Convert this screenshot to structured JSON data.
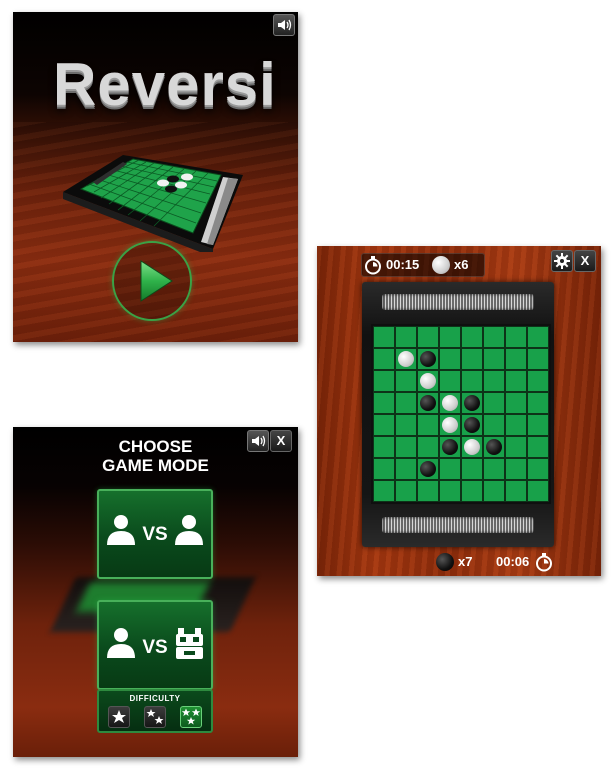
{
  "title_screen": {
    "logo": "Reversi",
    "sound_icon": "speaker-icon",
    "play_icon": "play-icon"
  },
  "mode_screen": {
    "title_line1": "CHOOSE",
    "title_line2": "GAME MODE",
    "vs_label": "VS",
    "difficulty_label": "DIFFICULTY",
    "difficulty_levels": [
      1,
      2,
      3
    ],
    "selected_difficulty": 3,
    "close_label": "X"
  },
  "game_screen": {
    "opponent_timer": "00:15",
    "opponent_count": "x6",
    "player_count": "x7",
    "player_timer": "00:06",
    "close_label": "X",
    "board": [
      "........",
      ".WB.....",
      "..W.....",
      "..BWB...",
      "...WB...",
      "...BWB..",
      "..B.....",
      "........"
    ],
    "colors": {
      "board_green": "#18a14a",
      "accent_green": "#3aa246",
      "wood": "#a4360f"
    }
  }
}
